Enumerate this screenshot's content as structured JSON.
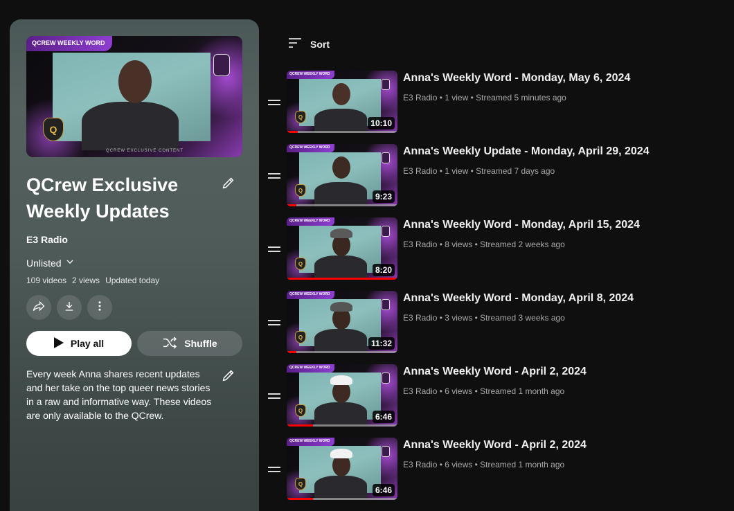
{
  "playlist": {
    "hero_tag": "QCREW WEEKLY WORD",
    "hero_footer": "QCREW EXCLUSIVE CONTENT",
    "title": "QCrew Exclusive Weekly Updates",
    "channel": "E3 Radio",
    "privacy": "Unlisted",
    "video_count": "109 videos",
    "views": "2 views",
    "updated": "Updated today",
    "play_all_label": "Play all",
    "shuffle_label": "Shuffle",
    "description": "Every week Anna shares recent updates and her take on the top queer news stories in a raw and informative way. These videos are only available to the QCrew."
  },
  "list": {
    "sort_label": "Sort",
    "videos": [
      {
        "title": "Anna's Weekly Word - Monday, May 6, 2024",
        "meta": "E3 Radio • 1 view • Streamed 5 minutes ago",
        "duration": "10:10",
        "progress": 0.1,
        "tag": "QCREW WEEKLY WORD"
      },
      {
        "title": "Anna's Weekly Update - Monday, April 29, 2024",
        "meta": "E3 Radio • 1 view • Streamed 7 days ago",
        "duration": "9:23",
        "progress": 0.09,
        "tag": "QCREW WEEKLY WORD"
      },
      {
        "title": "Anna's Weekly Word - Monday, April 15, 2024",
        "meta": "E3 Radio • 8 views • Streamed 2 weeks ago",
        "duration": "8:20",
        "progress": 1.0,
        "tag": "QCREW WEEKLY WORD"
      },
      {
        "title": "Anna's Weekly Word - Monday, April 8, 2024",
        "meta": "E3 Radio • 3 views • Streamed 3 weeks ago",
        "duration": "11:32",
        "progress": 0.09,
        "tag": "QCREW WEEKLY WORD"
      },
      {
        "title": "Anna's Weekly Word - April 2, 2024",
        "meta": "E3 Radio • 6 views • Streamed 1 month ago",
        "duration": "6:46",
        "progress": 0.24,
        "tag": "QCREW WEEKLY WORD"
      },
      {
        "title": "Anna's Weekly Word - April 2, 2024",
        "meta": "E3 Radio • 6 views • Streamed 1 month ago",
        "duration": "6:46",
        "progress": 0.24,
        "tag": "QCREW WEEKLY WORD"
      }
    ]
  },
  "colors": {
    "accent": "#ff0000",
    "tag_purple": "#8e3ed1",
    "panel": "#4f5b59"
  },
  "icons": {
    "sort": "sort-icon",
    "edit": "pencil-icon",
    "share": "share-icon",
    "download": "download-icon",
    "more": "more-vertical-icon",
    "play": "play-icon",
    "shuffle": "shuffle-icon",
    "drag": "drag-handle-icon"
  }
}
